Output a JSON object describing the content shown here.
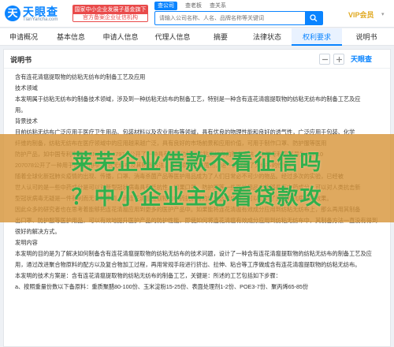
{
  "header": {
    "logo_mark": "天",
    "logo_text": "天眼查",
    "logo_sub": "TianYancha.com",
    "promo_line1": "国家中小企业发展子基金旗下",
    "promo_line2": "官方备案企业征信机构",
    "search_tabs": [
      "查公司",
      "查老板",
      "查关系"
    ],
    "search_placeholder": "请输入公司名称、人名、品牌名称等关键词",
    "vip_label": "VIP会员",
    "vip_caret": "▾"
  },
  "nav": {
    "tabs": [
      "申请概况",
      "基本信息",
      "申请人信息",
      "代理人信息",
      "摘要",
      "法律状态",
      "权利要求",
      "说明书"
    ],
    "active": "权利要求"
  },
  "doc": {
    "title": "说明书",
    "logo": "天眼查",
    "paragraphs": [
      "含有连花清瘟提取物的纺粘无纺布的制备工艺及应用",
      "技术领域",
      "本发明属于纺粘无纺布的制备技术领域，涉及到一种纺粘无纺布的制备工艺，特别是一种含有连花清瘟提取物的纺粘无纺布的制备工艺及应",
      "用。",
      "背景技术",
      "目前纺粘无纺布广泛应用于医疗卫生用品、包装材料以及农业用布等领域，具有优良的物理性能和良好的透气性，广泛应用于包装、化学",
      "纤维的制备，纺粘无纺布在医疗领域中的应用越来越广泛，具有良好的市场前景和应用价值，可用于制作口罩、防护服等医用",
      "防护产品，如中国专利申请号CN201120797.7公开了一种具有抗菌功能的纺粘无纺布的制备方法，中国专利申请号为201110",
      "207078公开了一种用于医用防护的复合无纺布及其制备方法，其中添加了抗菌剂，进一步提高了无纺布的性能。",
      "随着全球化新冠肺炎疫情的出现、传播，口罩、消毒杀菌产品等医护用品成为了人们日常必不可少的物品。经过多次的实验，已经被",
      "世人认可的是一些中药成分是可以对新型冠状病毒具有抵抗性。如果口罩、防护服等一些医护用品中能够具有中药成分，可以对人类抗击新",
      "型冠状病毒无疑是一件有利而无害的事情，而连花清瘟提取物为中药抗病毒的优先选择成分，可以起到了良好的抗病毒的效果。",
      "因此众多的研究者也在思考着能够把连花清瘟应用到更多的医护产品中。如果能将连花清瘟有效成分应用到纺粘无纺布上，那么再用其制备",
      "出口罩、防护服等医护用品，可以有效地提升医护产品的防护性能，即使如何将连花清瘟有效成分应用到纺粘无纺布中，其制备方法一直没有得到很好的解决方式。",
      "发明内容",
      "本发明的目的是为了解决如何制备含有连花清瘟提取物的纺粘无纺布的技术问题，设计了一种含有连花清瘟提取物的纺粘无纺布的制备工艺及应",
      "用，通过改进聚合物原料的配方以及复合物加工过程，再用常规手段进行挤出、拉伸、粘合等工序做成含有连花清瘟提取物的纺粘无纺布。",
      "本发明的技术方案是：含有连花清瘟提取物的纺粘无纺布的制备工艺，关键是：所述的工艺包括如下步骤：",
      "a、按照重量份数以下备原料：重质聚醋80-100份、玉米淀粉15-25份、表面处理剂1-2份、POE3-7份、聚丙烯65-85份"
    ]
  },
  "overlay": {
    "line1": "莱芜企业借款不看征信吗",
    "line2": "？中小企业主必看贷款攻"
  },
  "colors": {
    "brand": "#0a84ff",
    "vip": "#e0a81e",
    "promo": "#e94a4a",
    "overlay_bg": "#d8963c",
    "overlay_text": "#2fb04c"
  }
}
